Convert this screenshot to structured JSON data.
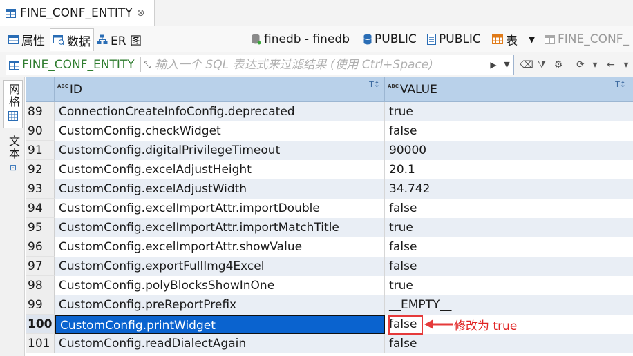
{
  "editor_tab": {
    "title": "FINE_CONF_ENTITY",
    "close": "⊗"
  },
  "view_tabs": [
    {
      "label": "属性"
    },
    {
      "label": "数据"
    },
    {
      "label": "ER 图"
    }
  ],
  "breadcrumbs": {
    "datasource": "finedb - finedb",
    "catalog": "PUBLIC",
    "schema": "PUBLIC",
    "object_type": "表",
    "object": "FINE_CONF_"
  },
  "filter": {
    "entity": "FINE_CONF_ENTITY",
    "placeholder": "输入一个 SQL 表达式来过滤结果 (使用 Ctrl+Space)"
  },
  "side_tabs": {
    "grid": "网格",
    "text": "文本"
  },
  "columns": {
    "id": "ID",
    "value": "VALUE"
  },
  "rows": [
    {
      "num": "89",
      "id": "ConnectionCreateInfoConfig.deprecated",
      "value": "true"
    },
    {
      "num": "90",
      "id": "CustomConfig.checkWidget",
      "value": "false"
    },
    {
      "num": "91",
      "id": "CustomConfig.digitalPrivilegeTimeout",
      "value": "90000"
    },
    {
      "num": "92",
      "id": "CustomConfig.excelAdjustHeight",
      "value": "20.1"
    },
    {
      "num": "93",
      "id": "CustomConfig.excelAdjustWidth",
      "value": "34.742"
    },
    {
      "num": "94",
      "id": "CustomConfig.excelImportAttr.importDouble",
      "value": "false"
    },
    {
      "num": "95",
      "id": "CustomConfig.excelImportAttr.importMatchTitle",
      "value": "true"
    },
    {
      "num": "96",
      "id": "CustomConfig.excelImportAttr.showValue",
      "value": "false"
    },
    {
      "num": "97",
      "id": "CustomConfig.exportFullImg4Excel",
      "value": "false"
    },
    {
      "num": "98",
      "id": "CustomConfig.polyBlocksShowInOne",
      "value": "true"
    },
    {
      "num": "99",
      "id": "CustomConfig.preReportPrefix",
      "value": "__EMPTY__"
    },
    {
      "num": "100",
      "id": "CustomConfig.printWidget",
      "value": "false"
    },
    {
      "num": "101",
      "id": "CustomConfig.readDialectAgain",
      "value": "false"
    }
  ],
  "annotation": {
    "text": "修改为 true",
    "color": "#e02424"
  },
  "colors": {
    "header_bg": "#b9d1ea",
    "selection": "#0a63cf",
    "alt_row": "#e9eef5"
  }
}
